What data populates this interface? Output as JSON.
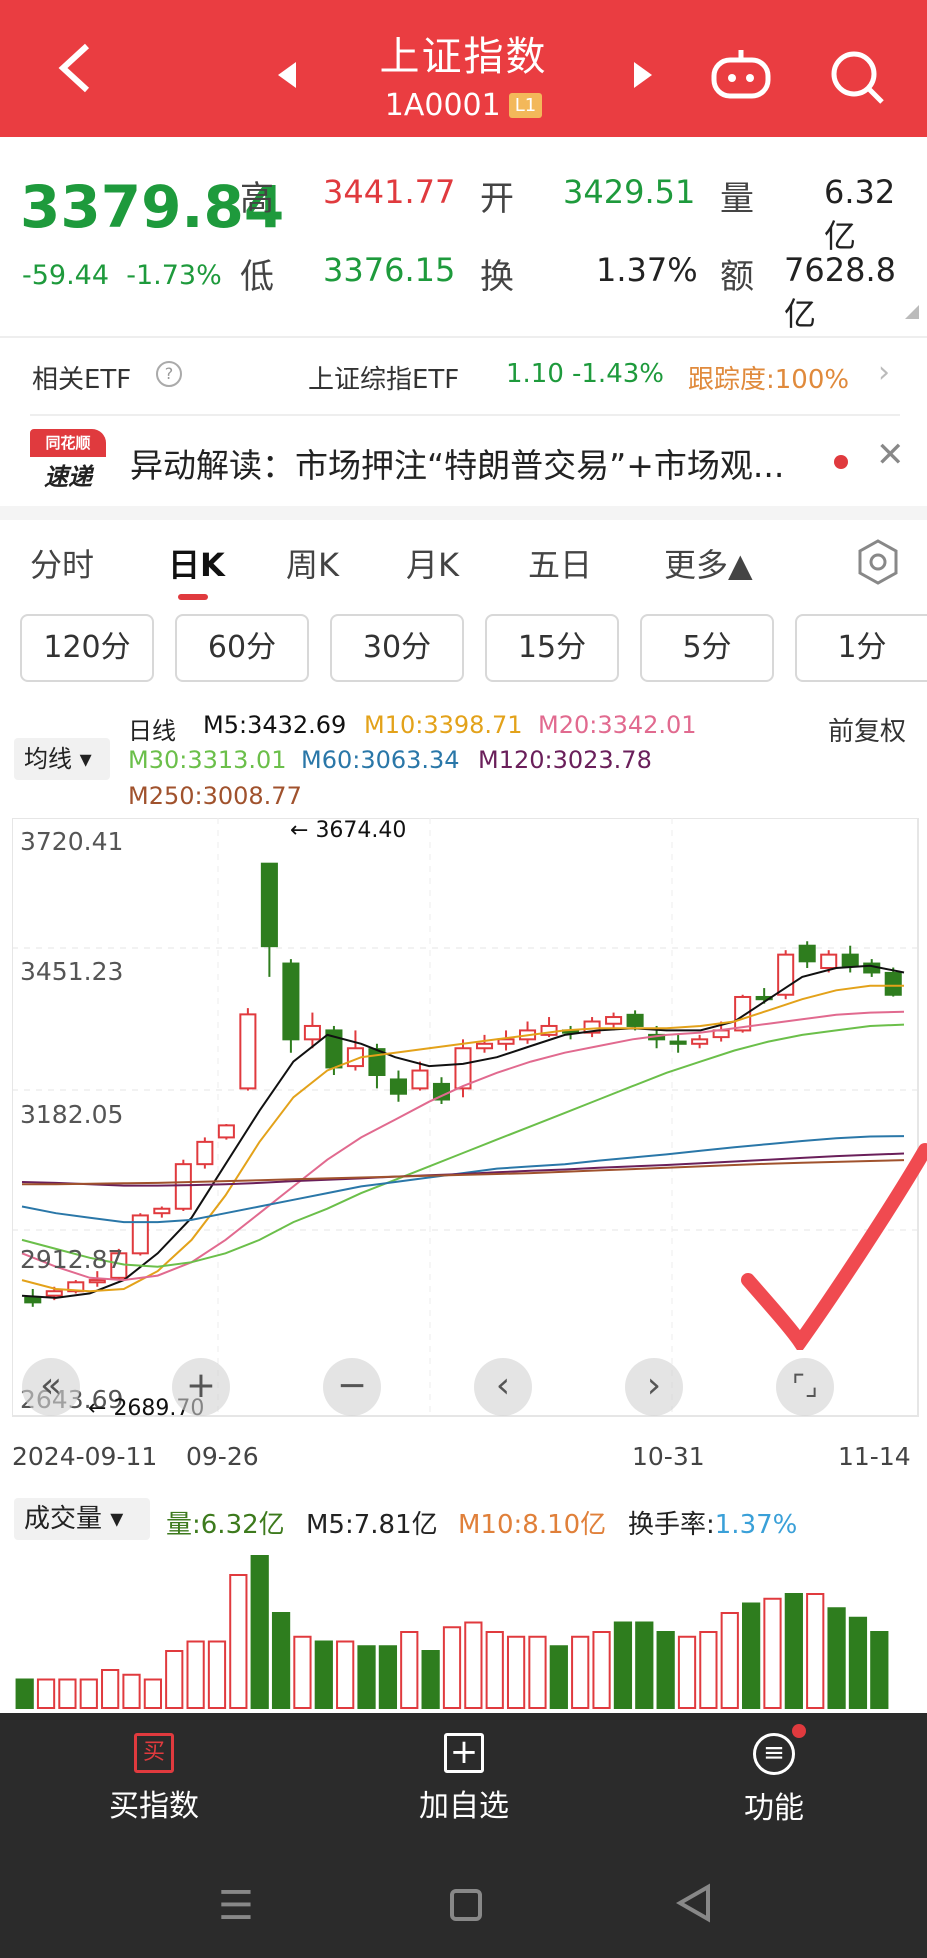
{
  "header": {
    "title": "上证指数",
    "code": "1A0001",
    "level": "L1"
  },
  "quote": {
    "price": "3379.84",
    "change": "-59.44",
    "change_pct": "-1.73%",
    "high_label": "高",
    "high": "3441.77",
    "open_label": "开",
    "open": "3429.51",
    "vol_label": "量",
    "vol": "6.32亿",
    "low_label": "低",
    "low": "3376.15",
    "turn_label": "换",
    "turn": "1.37%",
    "amt_label": "额",
    "amt": "7628.8亿"
  },
  "etf": {
    "label": "相关ETF",
    "name": "上证综指ETF",
    "price": "1.10",
    "pct": "-1.43%",
    "track": "跟踪度:100%"
  },
  "news": {
    "logo_top": "同花顺",
    "logo_bottom": "速递",
    "text": "异动解读：市场押注“特朗普交易”+市场观..."
  },
  "tabs": [
    "分时",
    "日K",
    "周K",
    "月K",
    "五日",
    "更多▲"
  ],
  "periods": [
    "120分",
    "60分",
    "30分",
    "15分",
    "5分",
    "1分"
  ],
  "ma": {
    "label": "日线",
    "mode": "均线",
    "restore": "前复权",
    "m5": "M5:3432.69",
    "m10": "M10:3398.71",
    "m20": "M20:3342.01",
    "m30": "M30:3313.01",
    "m60": "M60:3063.34",
    "m120": "M120:3023.78",
    "m250": "M250:3008.77"
  },
  "chart_data": {
    "type": "candlestick",
    "y_ticks": [
      "3720.41",
      "3451.23",
      "3182.05",
      "2912.87"
    ],
    "y_bottom_label": "2643.69",
    "high_note": "3674.40",
    "low_note": "2689.70",
    "x_labels": [
      "2024-09-11",
      "09-26",
      "10-31",
      "11-14"
    ],
    "colors": {
      "up": "#e03a3e",
      "down": "#2e7d1e",
      "m5": "#111111",
      "m10": "#e3a21a",
      "m20": "#e16a8f",
      "m30": "#6bbf4a",
      "m60": "#2a77a8",
      "m120": "#6a1f5a",
      "m250": "#a0522d"
    }
  },
  "volume": {
    "label": "成交量",
    "vol": "量:6.32亿",
    "m5": "M5:7.81亿",
    "m10": "M10:8.10亿",
    "turn_label": "换手率:",
    "turn": "1.37%"
  },
  "bottom": {
    "buy": "买指数",
    "add": "加自选",
    "func": "功能",
    "buy_icon": "买"
  }
}
